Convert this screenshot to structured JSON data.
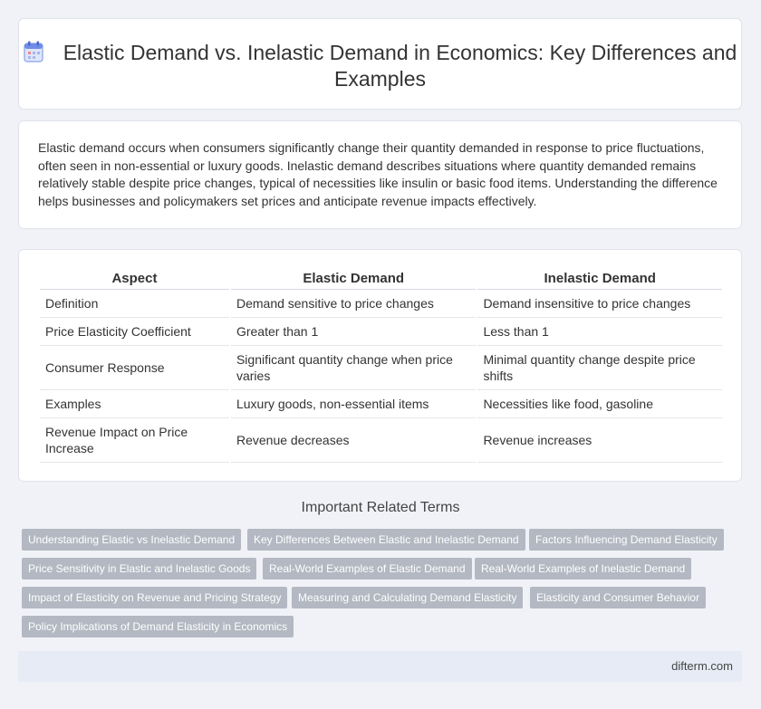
{
  "header": {
    "title": "Elastic Demand vs. Inelastic Demand in Economics: Key Differences and Examples",
    "icon": "calendar-icon"
  },
  "intro": {
    "text": "Elastic demand occurs when consumers significantly change their quantity demanded in response to price fluctuations, often seen in non-essential or luxury goods. Inelastic demand describes situations where quantity demanded remains relatively stable despite price changes, typical of necessities like insulin or basic food items. Understanding the difference helps businesses and policymakers set prices and anticipate revenue impacts effectively."
  },
  "table": {
    "headers": [
      "Aspect",
      "Elastic Demand",
      "Inelastic Demand"
    ],
    "rows": [
      [
        "Definition",
        "Demand sensitive to price changes",
        "Demand insensitive to price changes"
      ],
      [
        "Price Elasticity Coefficient",
        "Greater than 1",
        "Less than 1"
      ],
      [
        "Consumer Response",
        "Significant quantity change when price varies",
        "Minimal quantity change despite price shifts"
      ],
      [
        "Examples",
        "Luxury goods, non-essential items",
        "Necessities like food, gasoline"
      ],
      [
        "Revenue Impact on Price Increase",
        "Revenue decreases",
        "Revenue increases"
      ]
    ]
  },
  "related": {
    "heading": "Important Related Terms",
    "tags": [
      "Understanding Elastic vs Inelastic Demand",
      "Key Differences Between Elastic and Inelastic Demand",
      "Factors Influencing Demand Elasticity",
      "Price Sensitivity in Elastic and Inelastic Goods",
      "Real-World Examples of Elastic Demand",
      "Real-World Examples of Inelastic Demand",
      "Impact of Elasticity on Revenue and Pricing Strategy",
      "Measuring and Calculating Demand Elasticity",
      "Elasticity and Consumer Behavior",
      "Policy Implications of Demand Elasticity in Economics"
    ]
  },
  "footer": {
    "site": "difterm.com"
  },
  "colors": {
    "tag_bg": "#b3b8c2",
    "page_bg": "#f0f2f7",
    "footer_bg": "#e6ebf5"
  }
}
